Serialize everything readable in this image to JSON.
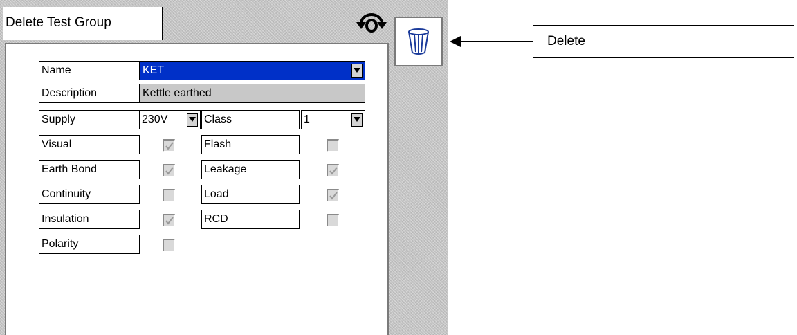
{
  "tab": {
    "title": "Delete Test Group"
  },
  "icons": {
    "refresh": "refresh-icon",
    "delete": "trash-icon",
    "dropdown": "dropdown-arrow-icon",
    "check": "checkmark-icon"
  },
  "form": {
    "name_label": "Name",
    "name_value": "KET",
    "description_label": "Description",
    "description_value": "Kettle earthed",
    "supply_label": "Supply",
    "supply_value": "230V",
    "class_label": "Class",
    "class_value": "1",
    "tests_left": [
      {
        "label": "Visual",
        "checked": true
      },
      {
        "label": "Earth Bond",
        "checked": true
      },
      {
        "label": "Continuity",
        "checked": false
      },
      {
        "label": "Insulation",
        "checked": true
      },
      {
        "label": "Polarity",
        "checked": false
      }
    ],
    "tests_right": [
      {
        "label": "Flash",
        "checked": false
      },
      {
        "label": "Leakage",
        "checked": true
      },
      {
        "label": "Load",
        "checked": true
      },
      {
        "label": "RCD",
        "checked": false
      }
    ]
  },
  "annotation": {
    "label": "Delete"
  },
  "colors": {
    "selection": "#0030c8",
    "screen_bg": "#c4c4c4",
    "field_gray": "#c8c8c8"
  }
}
